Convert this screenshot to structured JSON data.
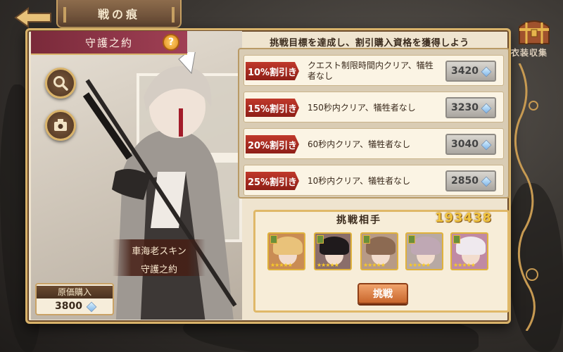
{
  "top": {
    "title": "戦の痕"
  },
  "section": {
    "title": "守護之約"
  },
  "help": {
    "glyph": "?"
  },
  "char": {
    "skin_label": "車海老スキン",
    "skin_name": "守護之約"
  },
  "purchase": {
    "label": "原価購入",
    "price": "3800"
  },
  "banner": "挑戦目標を達成し、割引購入資格を獲得しよう",
  "conditions": [
    {
      "tag": "10%割引き",
      "text": "クエスト制限時間内クリア、犠牲者なし",
      "price": "3420"
    },
    {
      "tag": "15%割引き",
      "text": "150秒内クリア、犠牲者なし",
      "price": "3230"
    },
    {
      "tag": "20%割引き",
      "text": "60秒内クリア、犠牲者なし",
      "price": "3040"
    },
    {
      "tag": "25%割引き",
      "text": "10秒内クリア、犠牲者なし",
      "price": "2850"
    }
  ],
  "challenger": {
    "title": "挑戦相手",
    "score": "193438",
    "button": "挑戦",
    "portraits": [
      {
        "hair": "#e9c27a",
        "bg": "#c98c54"
      },
      {
        "hair": "#1f1a1c",
        "bg": "#8a6e6a"
      },
      {
        "hair": "#8c6a52",
        "bg": "#b79a86"
      },
      {
        "hair": "#bfa8b4",
        "bg": "#b7a9a4"
      },
      {
        "hair": "#efe9ee",
        "bg": "#c08aa4"
      }
    ]
  },
  "chest": {
    "label": "衣装収集"
  },
  "colors": {
    "accent": "#d9b36a",
    "tag_red": "#c0392b",
    "header_crimson": "#a04055"
  },
  "icons": [
    "back-arrow-icon",
    "search-icon",
    "camera-icon",
    "help-icon",
    "gem-icon",
    "chest-icon"
  ]
}
